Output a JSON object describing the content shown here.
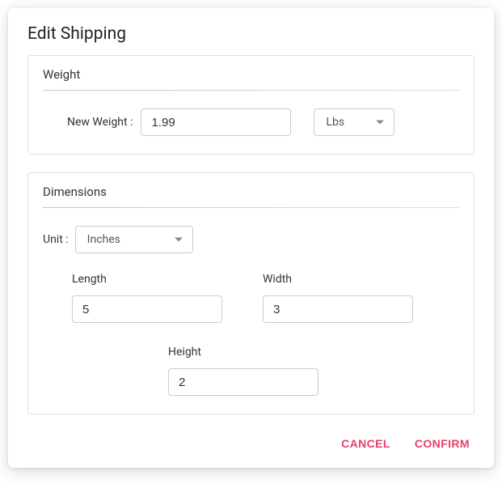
{
  "dialog": {
    "title": "Edit Shipping"
  },
  "weight": {
    "cardTitle": "Weight",
    "label": "New Weight :",
    "value": "1.99",
    "unit": "Lbs"
  },
  "dimensions": {
    "cardTitle": "Dimensions",
    "unitLabel": "Unit :",
    "unit": "Inches",
    "lengthLabel": "Length",
    "lengthValue": "5",
    "widthLabel": "Width",
    "widthValue": "3",
    "heightLabel": "Height",
    "heightValue": "2"
  },
  "actions": {
    "cancel": "CANCEL",
    "confirm": "CONFIRM"
  }
}
